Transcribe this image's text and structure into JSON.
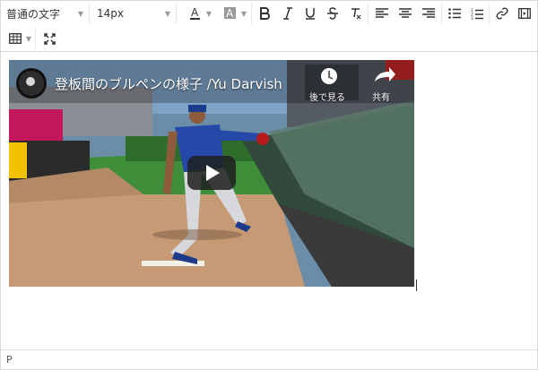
{
  "toolbar": {
    "block_format": "普通の文字",
    "font_size": "14px",
    "icons": [
      "text-color-icon",
      "background-color-icon",
      "bold-icon",
      "italic-icon",
      "underline-icon",
      "strikethrough-icon",
      "clear-format-icon",
      "align-left-icon",
      "align-center-icon",
      "align-right-icon",
      "bullet-list-icon",
      "numbered-list-icon",
      "link-icon",
      "media-icon",
      "table-icon",
      "fullscreen-icon"
    ]
  },
  "video": {
    "title": "登板間のブルペンの様子 /Yu Darvish",
    "watch_later_label": "後で見る",
    "share_label": "共有"
  },
  "status": {
    "path": "P"
  },
  "colors": {
    "border": "#d9d9d9",
    "play_button": "#1f1f1f"
  }
}
